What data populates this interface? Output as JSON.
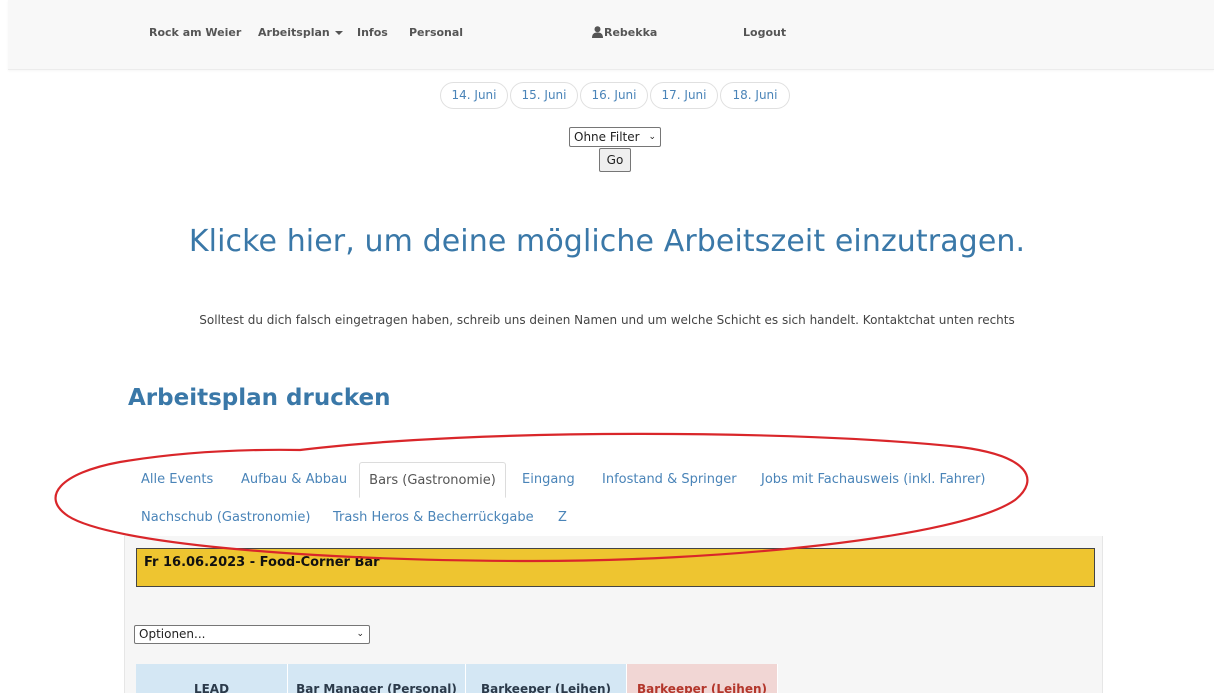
{
  "navbar": {
    "brand": "Rock am Weier",
    "menu_arbeitsplan": "Arbeitsplan",
    "menu_infos": "Infos",
    "menu_personal": "Personal",
    "user_name": "Rebekka",
    "logout": "Logout"
  },
  "days": [
    "14. Juni",
    "15. Juni",
    "16. Juni",
    "17. Juni",
    "18. Juni"
  ],
  "filter": {
    "selected": "Ohne Filter",
    "go_label": "Go"
  },
  "heading_link": "Klicke hier, um deine mögliche Arbeitszeit einzutragen.",
  "info_text": "Solltest du dich falsch eingetragen haben, schreib uns deinen Namen und um welche Schicht es sich handelt. Kontaktchat unten rechts",
  "section_title": "Arbeitsplan drucken",
  "tabs": [
    "Alle Events",
    "Aufbau & Abbau",
    "Bars (Gastronomie)",
    "Eingang",
    "Infostand & Springer",
    "Jobs mit Fachausweis (inkl. Fahrer)",
    "Nachschub (Gastronomie)",
    "Trash Heros & Becherrückgabe",
    "Z"
  ],
  "active_tab": "Bars (Gastronomie)",
  "event": {
    "title": "Fr 16.06.2023 - Food-Corner Bar",
    "options_selected": "Optionen...",
    "columns": [
      "LEAD",
      "Bar Manager (Personal)",
      "Barkeeper (Leihen)",
      "Barkeeper (Leihen)"
    ]
  },
  "colors": {
    "accent": "#3a78a8",
    "event_bar": "#eec530",
    "annotation": "#d9262a",
    "col_blue": "#d4e7f4",
    "col_red": "#f1d6d4"
  }
}
